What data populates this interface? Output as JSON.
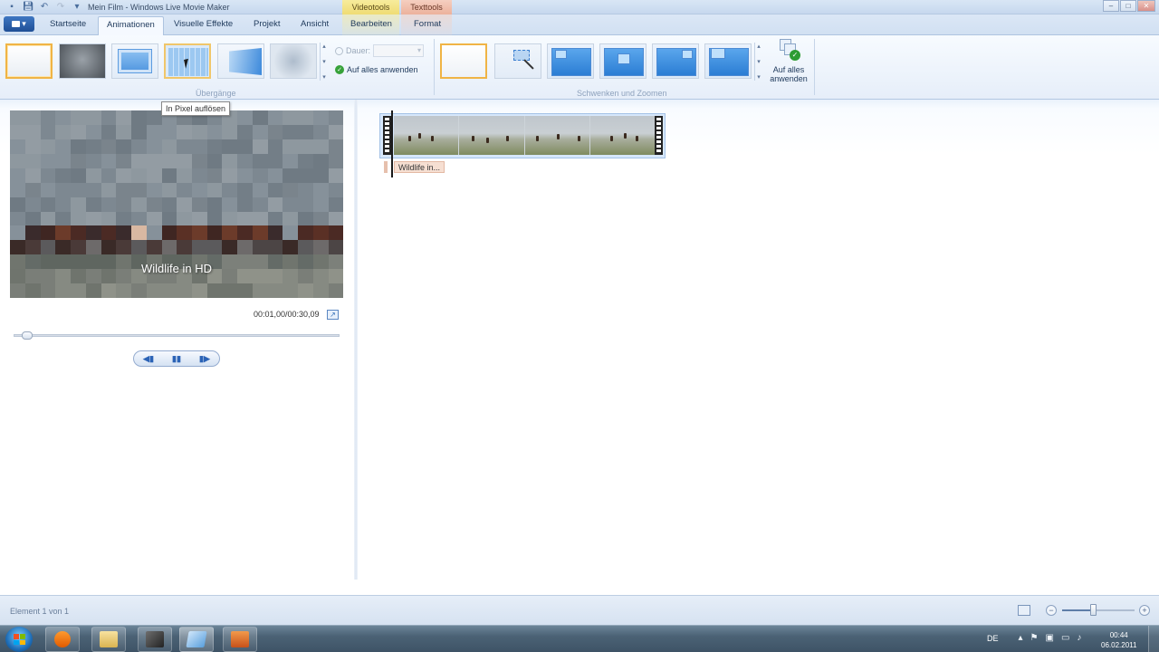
{
  "window": {
    "title": "Mein Film - Windows Live Movie Maker",
    "context_tabs": {
      "video": "Videotools",
      "text": "Texttools"
    },
    "buttons": {
      "minimize": "–",
      "maximize": "□",
      "close": "✕"
    }
  },
  "quick_access": [
    "save-icon",
    "undo-icon",
    "redo-icon",
    "dropdown-icon"
  ],
  "app_menu": {
    "label": "▾"
  },
  "tabs": [
    {
      "label": "Startseite"
    },
    {
      "label": "Animationen"
    },
    {
      "label": "Visuelle Effekte"
    },
    {
      "label": "Projekt"
    },
    {
      "label": "Ansicht"
    },
    {
      "label": "Bearbeiten"
    },
    {
      "label": "Format"
    }
  ],
  "active_tab": "Animationen",
  "ribbon": {
    "transitions": {
      "group_label": "Übergänge",
      "items": [
        "Keine",
        "Überblenden",
        "Kasten",
        "In Pixel auflösen",
        "Umblättern",
        "Weichzeichnen"
      ],
      "selected": "Keine",
      "hovered": "In Pixel auflösen",
      "duration_label": "Dauer:",
      "duration_value": "",
      "apply_all_label": "Auf alles anwenden"
    },
    "pan_zoom": {
      "group_label": "Schwenken und Zoomen",
      "selected": "Keine",
      "apply_all_label": "Auf alles anwenden"
    }
  },
  "tooltip": "In Pixel auflösen",
  "preview": {
    "caption": "Wildlife in HD",
    "timecode": "00:01,00/00:30,09",
    "seek_fraction": 0.03,
    "controls": {
      "prev": "◀▮",
      "pause": "▮▮",
      "next": "▮▶"
    }
  },
  "timeline": {
    "clip_caption": "Wildlife in..."
  },
  "status": {
    "text": "Element 1 von 1",
    "zoom_minus": "−",
    "zoom_plus": "+",
    "zoom_fraction": 0.42
  },
  "taskbar": {
    "apps": [
      "media-player",
      "explorer",
      "movie-maker",
      "thumbnail",
      "office"
    ],
    "language": "DE",
    "time": "00:44",
    "date": "06.02.2011"
  },
  "colors": {
    "selected_border": "#f0b445",
    "accent_blue": "#2b7dd4",
    "caption_chip": "#f6dfd2"
  }
}
